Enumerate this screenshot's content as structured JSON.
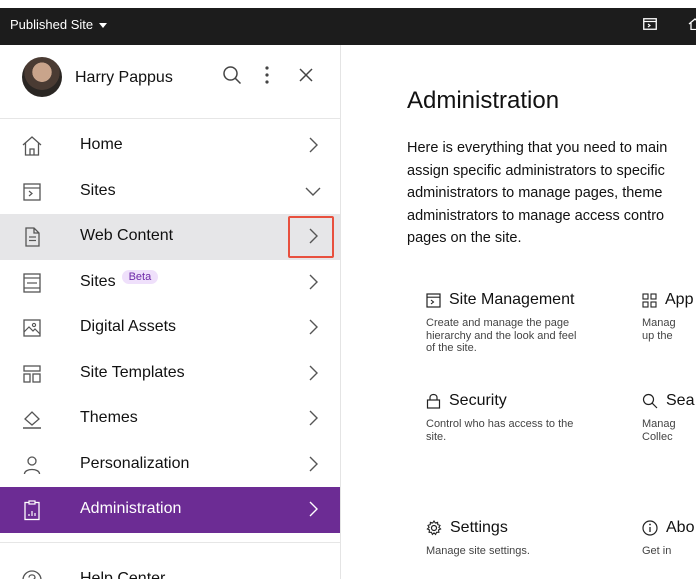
{
  "topbar": {
    "site_label": "Published Site"
  },
  "user": {
    "name": "Harry Pappus"
  },
  "nav": {
    "items": [
      {
        "label": "Home",
        "icon": "home-icon"
      },
      {
        "label": "Sites",
        "icon": "sites-icon"
      },
      {
        "label": "Web Content",
        "icon": "web-content-icon"
      },
      {
        "label": "Sites",
        "badge": "Beta",
        "icon": "sites-beta-icon"
      },
      {
        "label": "Digital Assets",
        "icon": "digital-assets-icon"
      },
      {
        "label": "Site Templates",
        "icon": "site-templates-icon"
      },
      {
        "label": "Themes",
        "icon": "themes-icon"
      },
      {
        "label": "Personalization",
        "icon": "personalization-icon"
      },
      {
        "label": "Administration",
        "icon": "administration-icon"
      }
    ],
    "help_label": "Help Center"
  },
  "main": {
    "title": "Administration",
    "intro_lines": [
      "Here is everything that you need to main",
      "assign specific administrators to specific",
      "administrators to manage pages, theme",
      "administrators to manage access contro",
      "pages on the site."
    ],
    "cards": [
      {
        "title": "Site Management",
        "desc": [
          "Create and manage the page",
          "hierarchy and the look and feel",
          "of the site."
        ]
      },
      {
        "title": "App",
        "desc": [
          "Manag",
          "up the"
        ]
      },
      {
        "title": "Security",
        "desc": [
          "Control who has access to the",
          "site."
        ]
      },
      {
        "title": "Sea",
        "desc": [
          "Manag",
          "Collec"
        ]
      },
      {
        "title": "Settings",
        "desc": [
          "Manage site settings."
        ]
      },
      {
        "title": "Abo",
        "desc": [
          "Get in"
        ]
      }
    ]
  },
  "colors": {
    "topbar": "#1c1c1c",
    "selected": "#6c2c94",
    "highlight": "#e8503e",
    "badge_bg": "#efe0fb",
    "badge_fg": "#6d28a8"
  }
}
